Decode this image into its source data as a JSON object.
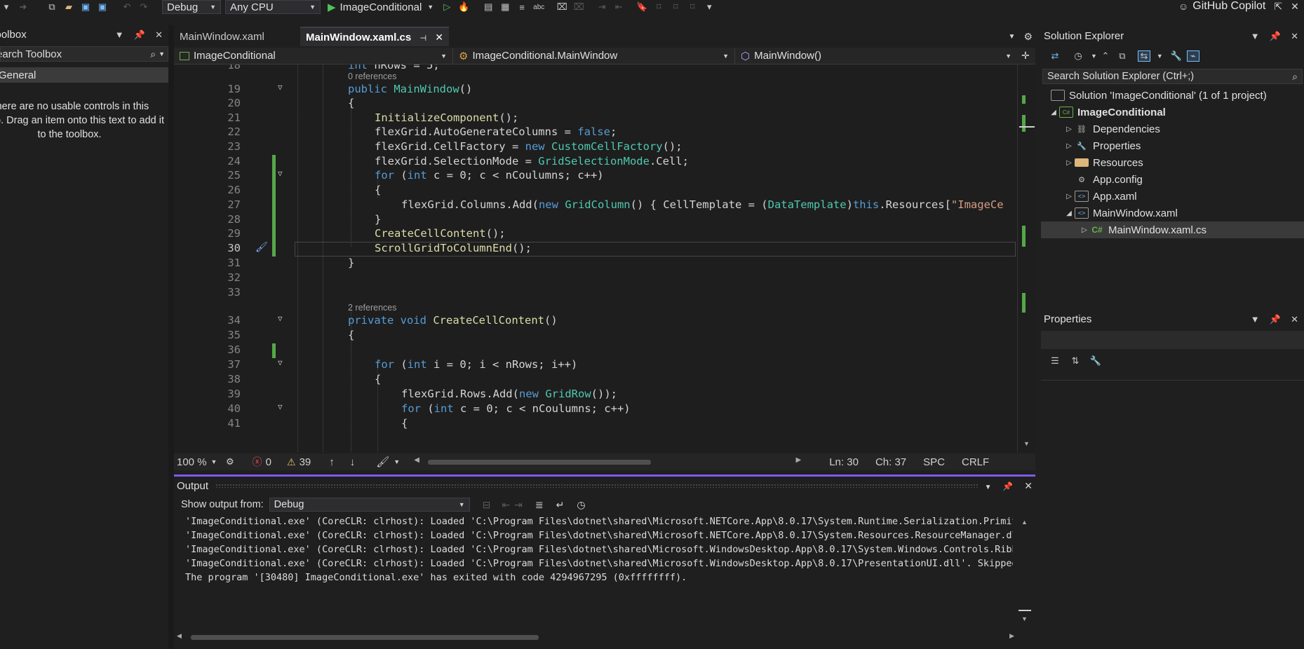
{
  "toolbar": {
    "config": "Debug",
    "platform": "Any CPU",
    "startup_project": "ImageConditional",
    "copilot_label": "GitHub Copilot"
  },
  "toolbox": {
    "title": "Toolbox",
    "search_placeholder": "Search Toolbox",
    "group": "General",
    "empty_message": "There are no usable controls in this group. Drag an item onto this text to add it to the toolbox."
  },
  "editor": {
    "tabs": [
      {
        "label": "MainWindow.xaml"
      },
      {
        "label": "MainWindow.xaml.cs"
      }
    ],
    "nav": {
      "project": "ImageConditional",
      "class": "ImageConditional.MainWindow",
      "member": "MainWindow()"
    },
    "lines": [
      {
        "n": "18",
        "text": "int nRows = 5;"
      },
      {
        "ref": "0 references"
      },
      {
        "n": "19",
        "text": "public MainWindow()"
      },
      {
        "n": "20",
        "text": "{"
      },
      {
        "n": "21",
        "text": "InitializeComponent();"
      },
      {
        "n": "22",
        "text": "flexGrid.AutoGenerateColumns = false;"
      },
      {
        "n": "23",
        "text": "flexGrid.CellFactory = new CustomCellFactory();"
      },
      {
        "n": "24",
        "text": "flexGrid.SelectionMode = GridSelectionMode.Cell;"
      },
      {
        "n": "25",
        "text": "for (int c = 0; c < nCoulumns; c++)"
      },
      {
        "n": "26",
        "text": "{"
      },
      {
        "n": "27",
        "text": "flexGrid.Columns.Add(new GridColumn() { CellTemplate = (DataTemplate)this.Resources[\"ImageCe"
      },
      {
        "n": "28",
        "text": "}"
      },
      {
        "n": "29",
        "text": "CreateCellContent();"
      },
      {
        "n": "30",
        "text": "ScrollGridToColumnEnd();"
      },
      {
        "n": "31",
        "text": "}"
      },
      {
        "n": "32",
        "text": ""
      },
      {
        "n": "33",
        "text": ""
      },
      {
        "ref": "2 references"
      },
      {
        "n": "34",
        "text": "private void CreateCellContent()"
      },
      {
        "n": "35",
        "text": "{"
      },
      {
        "n": "36",
        "text": ""
      },
      {
        "n": "37",
        "text": "for (int i = 0; i < nRows; i++)"
      },
      {
        "n": "38",
        "text": "{"
      },
      {
        "n": "39",
        "text": "flexGrid.Rows.Add(new GridRow());"
      },
      {
        "n": "40",
        "text": "for (int c = 0; c < nCoulumns; c++)"
      },
      {
        "n": "41",
        "text": "{"
      }
    ],
    "status": {
      "zoom": "100 %",
      "errors": "0",
      "warnings": "39",
      "ln": "Ln: 30",
      "ch": "Ch: 37",
      "whitespace": "SPC",
      "eol": "CRLF"
    }
  },
  "output": {
    "title": "Output",
    "show_from_label": "Show output from:",
    "source": "Debug",
    "lines": [
      "'ImageConditional.exe' (CoreCLR: clrhost): Loaded 'C:\\Program Files\\dotnet\\shared\\Microsoft.NETCore.App\\8.0.17\\System.Runtime.Serialization.Primitiv",
      "'ImageConditional.exe' (CoreCLR: clrhost): Loaded 'C:\\Program Files\\dotnet\\shared\\Microsoft.NETCore.App\\8.0.17\\System.Resources.ResourceManager.dll'",
      "'ImageConditional.exe' (CoreCLR: clrhost): Loaded 'C:\\Program Files\\dotnet\\shared\\Microsoft.WindowsDesktop.App\\8.0.17\\System.Windows.Controls.Ribbon",
      "'ImageConditional.exe' (CoreCLR: clrhost): Loaded 'C:\\Program Files\\dotnet\\shared\\Microsoft.WindowsDesktop.App\\8.0.17\\PresentationUI.dll'. Skipped l",
      "The program '[30480] ImageConditional.exe' has exited with code 4294967295 (0xffffffff)."
    ]
  },
  "solution_explorer": {
    "title": "Solution Explorer",
    "search_placeholder": "Search Solution Explorer (Ctrl+;)",
    "items": [
      {
        "label": "Solution 'ImageConditional' (1 of 1 project)"
      },
      {
        "label": "ImageConditional"
      },
      {
        "label": "Dependencies"
      },
      {
        "label": "Properties"
      },
      {
        "label": "Resources"
      },
      {
        "label": "App.config"
      },
      {
        "label": "App.xaml"
      },
      {
        "label": "MainWindow.xaml"
      },
      {
        "label": "MainWindow.xaml.cs"
      }
    ]
  },
  "properties": {
    "title": "Properties"
  }
}
